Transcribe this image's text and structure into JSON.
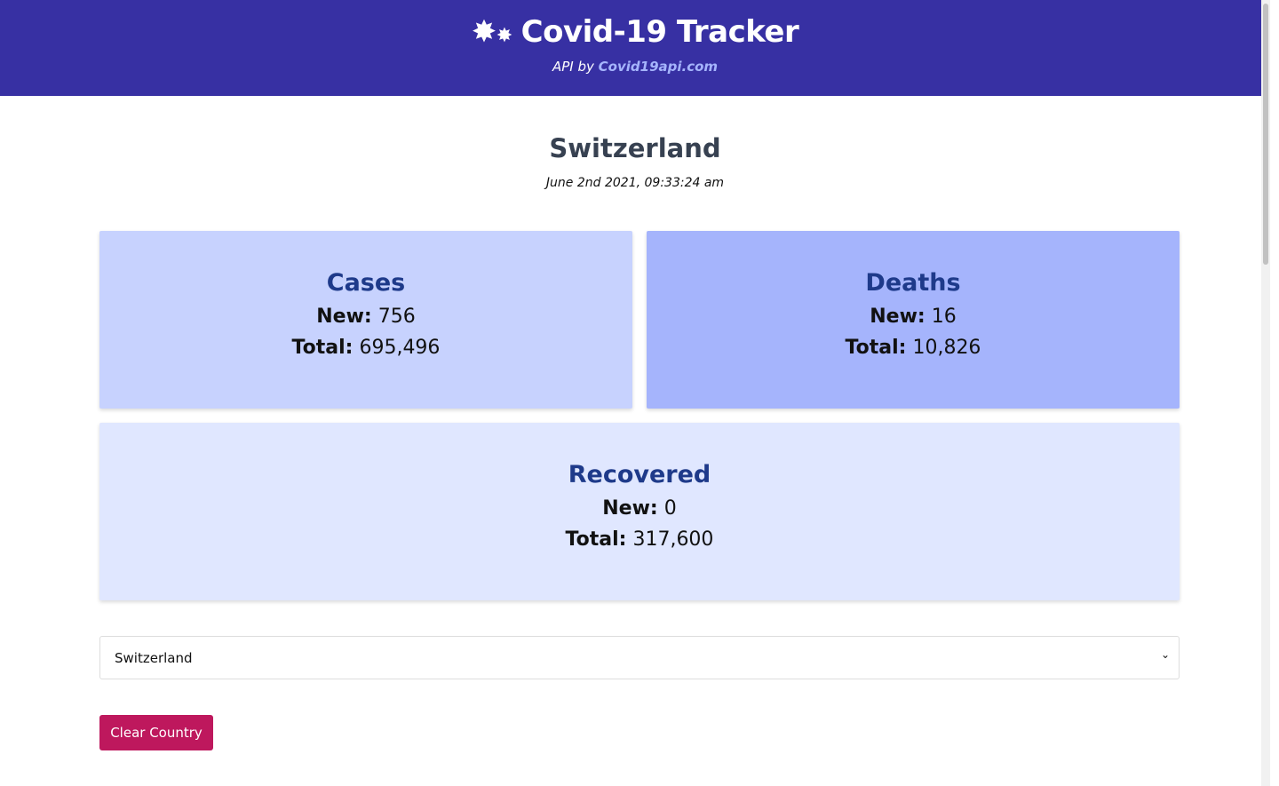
{
  "header": {
    "title": "Covid-19 Tracker",
    "api_prefix": "API by",
    "api_link": "Covid19api.com"
  },
  "country": {
    "name": "Switzerland",
    "date": "June 2nd 2021, 09:33:24 am"
  },
  "labels": {
    "new": "New:",
    "total": "Total:"
  },
  "cards": [
    {
      "title": "Cases",
      "new": "756",
      "total": "695,496",
      "color": "#c7d2fe"
    },
    {
      "title": "Deaths",
      "new": "16",
      "total": "10,826",
      "color": "#a5b4fc"
    },
    {
      "title": "Recovered",
      "new": "0",
      "total": "317,600",
      "color": "#e0e7ff"
    }
  ],
  "select": {
    "value": "Switzerland"
  },
  "clear_button": "Clear Country"
}
